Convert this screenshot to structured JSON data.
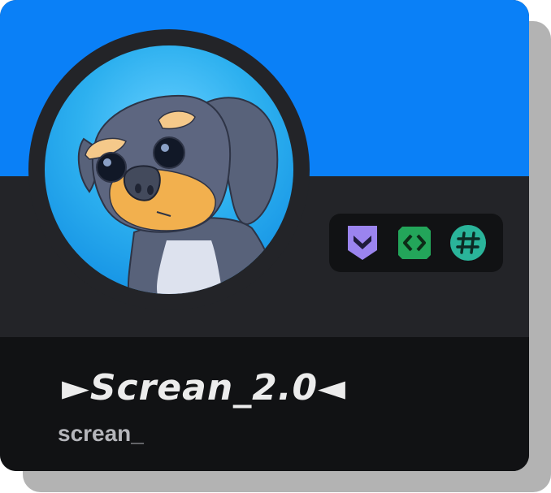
{
  "profile": {
    "display_name": "►Screan_2.0◄",
    "username": "screan_",
    "banner_color": "#0a80f7",
    "avatar_icon": "dog-avatar"
  },
  "badges": [
    {
      "name": "hypesquad-balance-badge",
      "color": "#9b84ee"
    },
    {
      "name": "active-developer-badge",
      "color": "#23a55a"
    },
    {
      "name": "originally-known-as-badge",
      "color": "#2ab49a"
    }
  ]
}
